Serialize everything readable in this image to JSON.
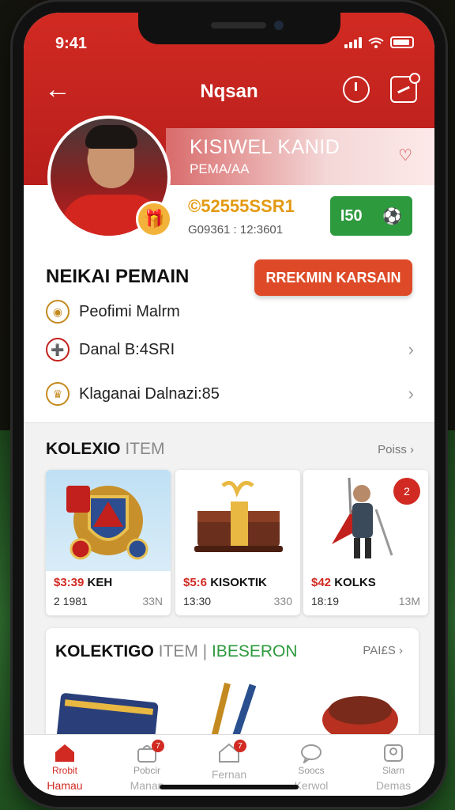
{
  "status": {
    "time": "9:41"
  },
  "nav": {
    "title": "Nqsan"
  },
  "profile": {
    "name": "KISIWEL KANID",
    "subtitle": "PEMA/AA",
    "coins": "©52555SSR1",
    "coins_sub": "G09361 : 12:3601",
    "level_label": "I50"
  },
  "section_player": {
    "title": "NEIKAI PEMAIN",
    "claim_button": "RREKMIN KARSAIN",
    "rows": [
      {
        "icon": "medal-icon",
        "label": "Peofimi Malrm"
      },
      {
        "icon": "target-icon",
        "label": "Danal B:4SRI"
      },
      {
        "icon": "trophy-icon",
        "label": "Klaganai Dalnazi:85"
      }
    ]
  },
  "collection": {
    "title_bold": "KOLEXIO",
    "title_thin": " ITEM",
    "more": "Poiss",
    "items": [
      {
        "price": "$3:39",
        "name": "KEH",
        "meta_left": "2 1981",
        "meta_right": "33N"
      },
      {
        "price": "$5:6",
        "name": "KISOKTIK",
        "meta_left": "13:30",
        "meta_right": "330"
      },
      {
        "price": "$42",
        "name": "KOLKS",
        "meta_left": "18:19",
        "meta_right": "13M",
        "badge": "2"
      }
    ]
  },
  "collection2": {
    "title_bold": "KOLEKTIGO",
    "title_thin": " ITEM |",
    "title_green": " IBESERON",
    "more": "PAI£S"
  },
  "tabs": [
    {
      "label": "Rrobit",
      "sub": "Hamau",
      "active": true
    },
    {
      "label": "Pobcir",
      "sub": "Manan",
      "badge": "7"
    },
    {
      "label": "",
      "sub": "Fernan",
      "badge": "7"
    },
    {
      "label": "Soocs",
      "sub": "Kerwol"
    },
    {
      "label": "Slarn",
      "sub": "Demas"
    }
  ],
  "colors": {
    "primary": "#d12a22",
    "accent_green": "#2e9a3e",
    "gold": "#e39a12"
  }
}
